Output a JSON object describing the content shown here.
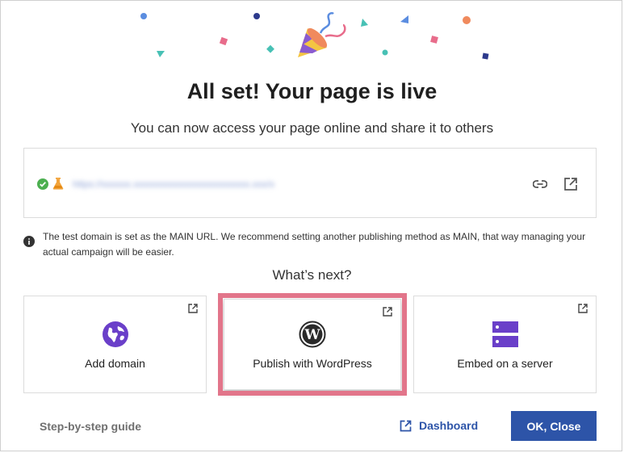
{
  "header": {
    "title": "All set! Your page is live",
    "subtitle": "You can now access your page online and share it to others"
  },
  "url_box": {
    "url": "https://xxxxxx.xxxxxxxxxxxxxxxxxxxxxxxx.xxx/x",
    "status_icon": "check-circle-icon",
    "test_icon": "flask-icon",
    "actions": [
      "link-icon",
      "external-link-icon"
    ]
  },
  "info": {
    "text": "The test domain is set as the MAIN URL. We recommend setting another publishing method as MAIN, that way managing your actual campaign will be easier."
  },
  "next": {
    "heading": "What’s next?",
    "cards": [
      {
        "label": "Add domain",
        "icon": "globe-icon"
      },
      {
        "label": "Publish with WordPress",
        "icon": "wordpress-icon"
      },
      {
        "label": "Embed on a server",
        "icon": "server-icon"
      }
    ]
  },
  "footer": {
    "guide_label": "Step-by-step guide",
    "dashboard_label": "Dashboard",
    "ok_label": "OK, Close"
  },
  "colors": {
    "primary": "#2d54a8",
    "purple": "#6a3fc9",
    "success": "#4caf50",
    "highlight": "#e2758a"
  }
}
